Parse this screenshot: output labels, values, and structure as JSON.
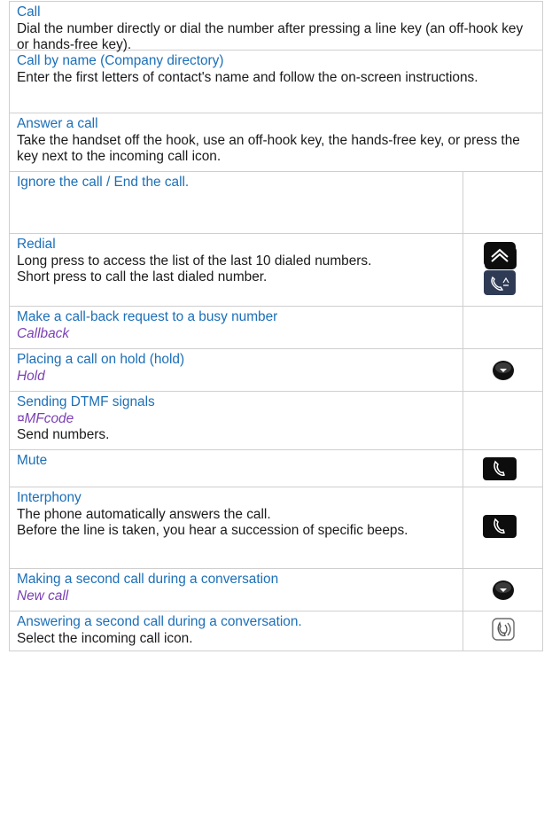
{
  "rows": [
    {
      "title": "Call",
      "body": "Dial the number directly or dial the number after pressing a line key (an off-hook key or hands-free key)."
    },
    {
      "title": "Call by name (Company directory)",
      "body": "Enter the first letters of contact's name and follow the on-screen instructions."
    },
    {
      "title": "Answer a call",
      "body": "Take the handset off the hook, use an off-hook key, the hands-free key, or press the key next to the incoming call icon."
    },
    {
      "title": "Ignore the call / End the call.",
      "icon": "hang-up-key-icon"
    },
    {
      "title": "Redial",
      "body": "Long press to access the list of the last 10 dialed numbers.\nShort press to call the last dialed number.",
      "icons": [
        "redial-key-icon",
        "redial-handset-icon"
      ]
    },
    {
      "title": "Make a call-back request to a busy number",
      "softkey": "Callback"
    },
    {
      "title": "Placing a call on hold (hold)",
      "softkey": "Hold",
      "icon": "navigator-button-icon"
    },
    {
      "title": "Sending DTMF signals",
      "softkey": "¤MFcode",
      "body": "Send numbers."
    },
    {
      "title": "Mute",
      "icon": "mute-key-icon"
    },
    {
      "title": "Interphony",
      "body": "The phone automatically answers the call.\nBefore the line is taken, you hear a succession of specific beeps.",
      "icon": "interphony-key-icon"
    },
    {
      "title": "Making a second call during a conversation",
      "softkey": "New call",
      "icon": "navigator-button-icon"
    },
    {
      "title": "Answering a second call during a conversation.",
      "body": "Select the incoming call icon.",
      "icon": "incoming-call-icon"
    }
  ],
  "colors": {
    "title": "#1b6fb8",
    "softkey": "#7a3fb5",
    "border": "#cfcfcf"
  }
}
